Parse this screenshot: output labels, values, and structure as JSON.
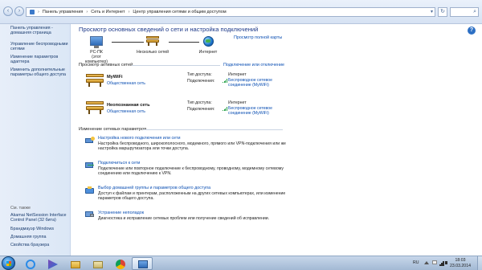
{
  "address_bar": {
    "crumbs": [
      "Панель управления",
      "Сеть и Интернет",
      "Центр управления сетями и общим доступом"
    ]
  },
  "left_nav": {
    "items": [
      "Панель управления - домашняя страница",
      "Управление беспроводными сетями",
      "Изменение параметров адаптера",
      "Изменить дополнительные параметры общего доступа"
    ],
    "see_also_title": "См. также",
    "see_also": [
      "Akamai NetSession Interface Control Panel (32 бита)",
      "Брандмауэр Windows",
      "Домашняя группа",
      "Свойства браузера"
    ]
  },
  "main": {
    "title": "Просмотр основных сведений о сети и настройка подключений",
    "full_map_link": "Просмотр полной карты",
    "map_nodes": [
      {
        "label": "PC-ПК",
        "sub": "(этот компьютер)"
      },
      {
        "label": "Несколько сетей",
        "sub": ""
      },
      {
        "label": "Интернет",
        "sub": ""
      }
    ],
    "active_networks_label": "Просмотр активных сетей",
    "connect_disconnect_link": "Подключение или отключение",
    "networks": [
      {
        "name": "MyWiFi",
        "type": "Общественная сеть",
        "access_label": "Тип доступа:",
        "access_value": "Интернет",
        "connections_label": "Подключения:",
        "connection_line1": "Беспроводное сетевое",
        "connection_line2": "соединение (MyWiFi)"
      },
      {
        "name": "Неопознанная сеть",
        "type": "Общественная сеть",
        "access_label": "Тип доступа:",
        "access_value": "Интернет",
        "connections_label": "Подключения:",
        "connection_line1": "Беспроводное сетевое",
        "connection_line2": "соединение (MyWiFi)"
      }
    ],
    "change_settings_label": "Изменение сетевых параметров",
    "tasks": [
      {
        "link": "Настройка нового подключения или сети",
        "desc": "Настройка беспроводного, широкополосного, модемного, прямого или VPN-подключения или же настройка маршрутизатора или точки доступа."
      },
      {
        "link": "Подключиться к сети",
        "desc": "Подключение или повторное подключение к беспроводному, проводному, модемному сетевому соединению или подключению к VPN."
      },
      {
        "link": "Выбор домашней группы и параметров общего доступа",
        "desc": "Доступ к файлам и принтерам, расположенным на других сетевых компьютерах, или изменение параметров общего доступа."
      },
      {
        "link": "Устранение неполадок",
        "desc": "Диагностика и исправление сетевых проблем или получение сведений об исправлении."
      }
    ]
  },
  "taskbar": {
    "apps": [
      "ie-icon",
      "explorer-icon",
      "media-player-icon",
      "folder-icon",
      "chrome-icon",
      "network-center-icon"
    ],
    "lang": "RU",
    "time": "18:03",
    "date": "23.03.2014"
  },
  "colors": {
    "link": "#0b4fb3",
    "title": "#1e3a8a",
    "nav_bg": "#dbe7f6",
    "taskbar": "#b3c6dd"
  }
}
